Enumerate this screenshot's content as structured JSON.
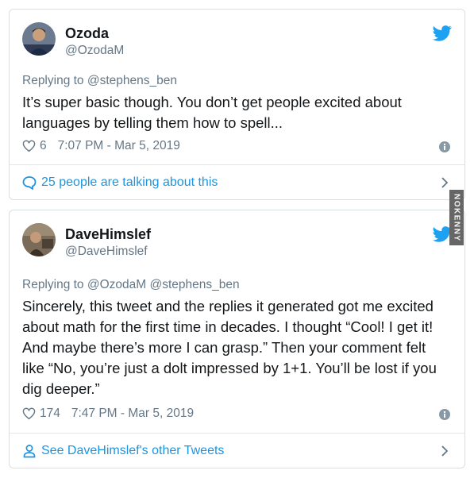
{
  "tweets": [
    {
      "name": "Ozoda",
      "handle": "@OzodaM",
      "replying": "Replying to @stephens_ben",
      "text_lines": [
        "It’s super basic though. You don’t get people excited about",
        "languages by telling them how to spell..."
      ],
      "likes": "6",
      "timestamp": "7:07 PM - Mar 5, 2019",
      "footer": "25 people are talking about this",
      "footer_icon": "speech-bubble-icon"
    },
    {
      "name": "DaveHimslef",
      "handle": "@DaveHimslef",
      "replying": "Replying to @OzodaM @stephens_ben",
      "text_lines": [
        "Sincerely, this tweet and the replies it generated got me excited",
        "about math for the first time in decades. I thought “Cool! I get it!",
        "And maybe there’s more I can grasp.” Then your comment felt",
        "like “No, you’re  just a dolt impressed by 1+1. You’ll be lost if you",
        "dig deeper.”"
      ],
      "likes": "174",
      "timestamp": "7:47 PM - Mar 5, 2019",
      "footer": "See DaveHimslef's other Tweets",
      "footer_icon": "person-icon"
    }
  ],
  "watermark": "NOKENNY",
  "colors": {
    "accent": "#1b95e0",
    "muted": "#657786",
    "text": "#14171a",
    "border": "#d8dfe3"
  }
}
